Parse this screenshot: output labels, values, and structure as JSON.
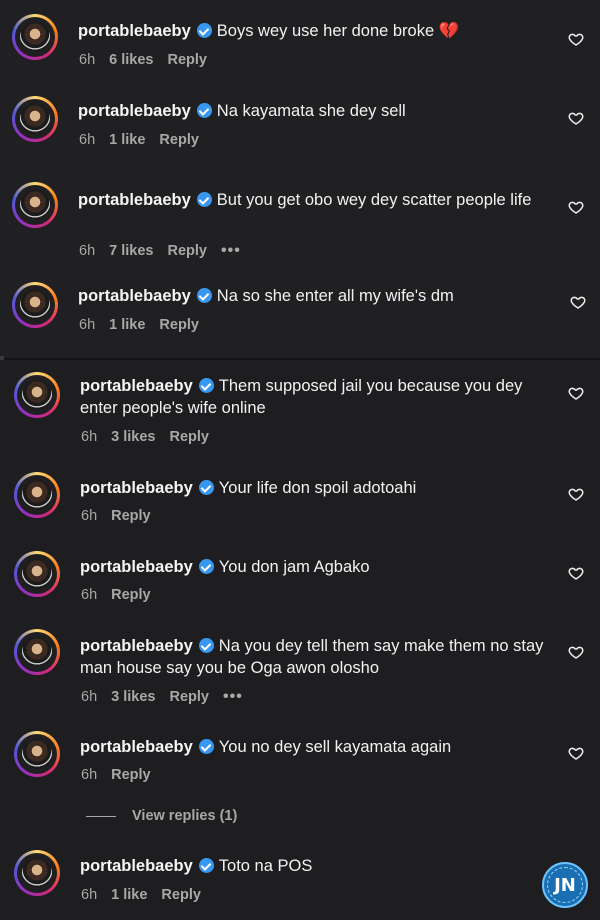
{
  "comments": [
    {
      "user": "portablebaeby",
      "text": "Boys wey use her done broke 💔",
      "time": "6h",
      "likes": "6 likes",
      "reply": "Reply",
      "more": ""
    },
    {
      "user": "portablebaeby",
      "text": "Na kayamata she dey sell",
      "time": "6h",
      "likes": "1 like",
      "reply": "Reply",
      "more": ""
    },
    {
      "user": "portablebaeby",
      "text": "But you get obo wey dey scatter people life",
      "time": "6h",
      "likes": "7 likes",
      "reply": "Reply",
      "more": "•••"
    },
    {
      "user": "portablebaeby",
      "text": "Na so she enter all my wife's dm",
      "time": "6h",
      "likes": "1 like",
      "reply": "Reply",
      "more": ""
    },
    {
      "user": "portablebaeby",
      "text": "Them supposed jail you because you dey enter people's wife online",
      "time": "6h",
      "likes": "3 likes",
      "reply": "Reply",
      "more": ""
    },
    {
      "user": "portablebaeby",
      "text": "Your life don spoil adotoahi",
      "time": "6h",
      "likes": "",
      "reply": "Reply",
      "more": ""
    },
    {
      "user": "portablebaeby",
      "text": "You don jam Agbako",
      "time": "6h",
      "likes": "",
      "reply": "Reply",
      "more": ""
    },
    {
      "user": "portablebaeby",
      "text": "Na you dey tell them say make them no stay man house say you be Oga awon olosho",
      "time": "6h",
      "likes": "3 likes",
      "reply": "Reply",
      "more": "•••"
    },
    {
      "user": "portablebaeby",
      "text": "You no dey sell kayamata again",
      "time": "6h",
      "likes": "",
      "reply": "Reply",
      "more": ""
    },
    {
      "user": "portablebaeby",
      "text": "Toto na POS",
      "time": "6h",
      "likes": "1 like",
      "reply": "Reply",
      "more": ""
    }
  ],
  "view_replies": "View replies (1)",
  "watermark": "JN",
  "colors": {
    "background": "#1f1f22",
    "verified": "#3897f0",
    "meta": "#a8a8a8"
  }
}
